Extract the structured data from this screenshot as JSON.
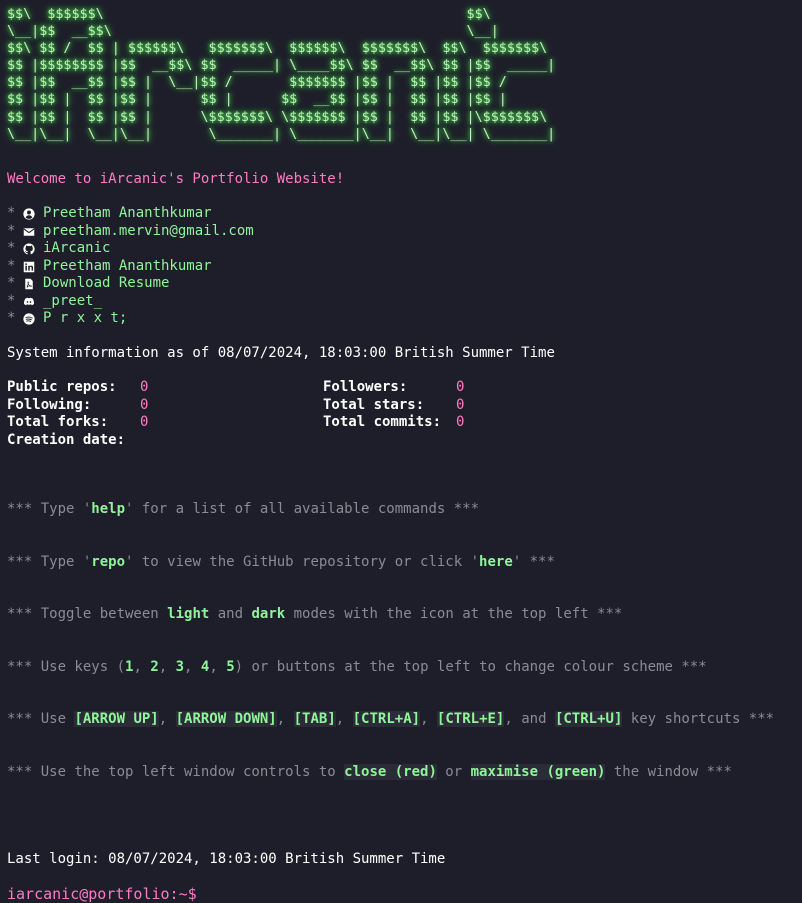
{
  "ascii_art": "$$\\  $$$$$$\\                                             $$\\\n\\__|$$  __$$\\                                            \\__|\n$$\\ $$ /  $$ | $$$$$$\\   $$$$$$$\\  $$$$$$\\  $$$$$$$\\  $$\\  $$$$$$$\\\n$$ |$$$$$$$$ |$$  __$$\\ $$  _____| \\____$$\\ $$  __$$\\ $$ |$$  _____|\n$$ |$$  __$$ |$$ |  \\__|$$ /       $$$$$$$ |$$ |  $$ |$$ |$$ /\n$$ |$$ |  $$ |$$ |      $$ |      $$  __$$ |$$ |  $$ |$$ |$$ |\n$$ |$$ |  $$ |$$ |      \\$$$$$$$\\ \\$$$$$$$ |$$ |  $$ |$$ |\\$$$$$$$\\\n\\__|\\__|  \\__|\\__|       \\_______| \\_______|\\__|  \\__|\\__| \\_______|",
  "welcome": "Welcome to iArcanic's Portfolio Website!",
  "bullet": "*",
  "links": [
    {
      "icon": "user-icon",
      "label": "Preetham Ananthkumar"
    },
    {
      "icon": "envelope-icon",
      "label": "preetham.mervin@gmail.com"
    },
    {
      "icon": "github-icon",
      "label": "iArcanic"
    },
    {
      "icon": "linkedin-icon",
      "label": "Preetham Ananthkumar"
    },
    {
      "icon": "pdf-file-icon",
      "label": "Download Resume"
    },
    {
      "icon": "discord-icon",
      "label": "_preet_"
    },
    {
      "icon": "spotify-icon",
      "label": "P r x x t;"
    }
  ],
  "system_info": "System information as of 08/07/2024, 18:03:00 British Summer Time",
  "stats": {
    "public_repos_label": "Public repos:",
    "public_repos": "0",
    "followers_label": "Followers:",
    "followers": "0",
    "following_label": "Following:",
    "following": "0",
    "total_stars_label": "Total stars:",
    "total_stars": "0",
    "total_forks_label": "Total forks:",
    "total_forks": "0",
    "total_commits_label": "Total commits:",
    "total_commits": "0",
    "creation_date_label": "Creation date:",
    "creation_date": ""
  },
  "tips": {
    "help": {
      "pre": "*** Type '",
      "key": "help",
      "post": "' for a list of all available commands ***"
    },
    "repo": {
      "pre": "*** Type '",
      "key": "repo",
      "mid": "' to view the GitHub repository or click '",
      "key2": "here",
      "post": "' ***"
    },
    "mode": {
      "pre": "*** Toggle between ",
      "key": "light",
      "mid": " and ",
      "key2": "dark",
      "post": " modes with the icon at the top left ***"
    },
    "keys": {
      "pre": "*** Use keys (",
      "k1": "1",
      "c1": ", ",
      "k2": "2",
      "c2": ", ",
      "k3": "3",
      "c3": ", ",
      "k4": "4",
      "c4": ", ",
      "k5": "5",
      "post": ") or buttons at the top left to change colour scheme ***"
    },
    "shortcuts": {
      "pre": "*** Use ",
      "k1": "[ARROW UP]",
      "c1": ", ",
      "k2": "[ARROW DOWN]",
      "c2": ", ",
      "k3": "[TAB]",
      "c3": ", ",
      "k4": "[CTRL+A]",
      "c4": ", ",
      "k5": "[CTRL+E]",
      "c5": ", and ",
      "k6": "[CTRL+U]",
      "post": " key shortcuts ***"
    },
    "window": {
      "pre": "*** Use the top left window controls to ",
      "key": "close (red)",
      "mid": " or ",
      "key2": "maximise (green)",
      "post": " the window ***"
    }
  },
  "last_login": "Last login: 08/07/2024, 18:03:00 British Summer Time",
  "prompt": "iarcanic@portfolio:~$"
}
